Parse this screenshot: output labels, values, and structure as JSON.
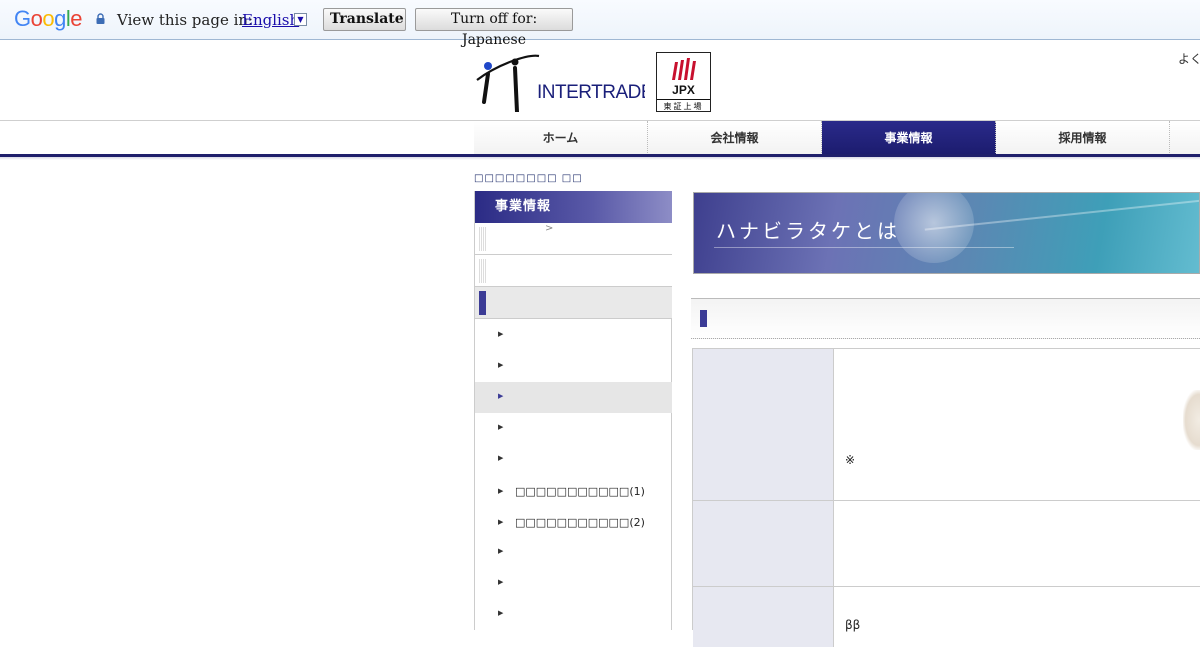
{
  "translate_bar": {
    "logo": "Google",
    "prompt": "View this page in:",
    "language": "English",
    "translate_button": "Translate",
    "turn_off_button": "Turn off for: Japanese"
  },
  "header": {
    "company_logo_text": "INTERTRADE",
    "badge_text": "JPX",
    "badge_sub": "東証上場",
    "top_right_text": "よく"
  },
  "nav": {
    "items": [
      {
        "label": "ホーム"
      },
      {
        "label": "会社情報"
      },
      {
        "label": "事業情報"
      },
      {
        "label": "採用情報"
      }
    ],
    "active": "事業情報"
  },
  "breadcrumb": "□□□□□□□□  □□",
  "sidebar": {
    "heading": "事業情報",
    "categories": [
      {
        "label": "",
        "extra": ">"
      },
      {
        "label": "",
        "extra": ""
      },
      {
        "label": "",
        "extra": ""
      }
    ],
    "subitems": [
      {
        "label": ""
      },
      {
        "label": ""
      },
      {
        "label": ""
      },
      {
        "label": ""
      },
      {
        "label": ""
      },
      {
        "label": "□□□□□□□□□□□(1)"
      },
      {
        "label": "□□□□□□□□□□□(2)"
      },
      {
        "label": ""
      },
      {
        "label": ""
      },
      {
        "label": ""
      }
    ]
  },
  "main": {
    "banner_title": "ハナビラタケとは",
    "table_notes": [
      "※",
      "ββ"
    ]
  }
}
